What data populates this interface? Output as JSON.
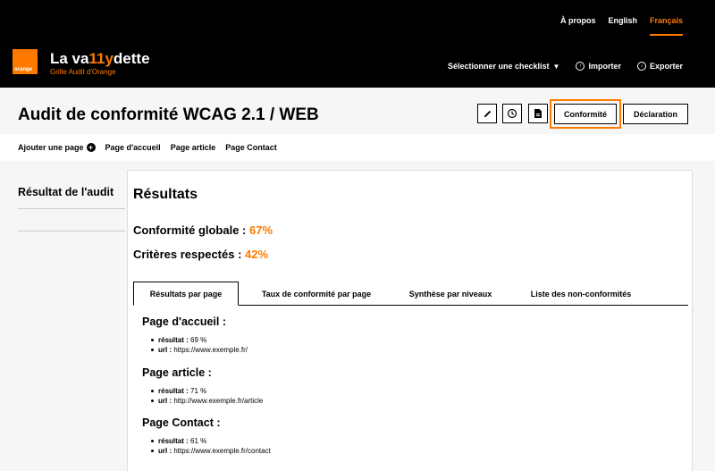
{
  "header": {
    "lang_nav": {
      "about": "À propos",
      "english": "English",
      "french": "Français"
    },
    "logo_text": "orange",
    "app_title_a": "La va",
    "app_title_b": "11y",
    "app_title_c": "dette",
    "app_subtitle": "Grille Audit d'Orange",
    "select_checklist": "Sélectionner une checklist",
    "import": "Importer",
    "export": "Exporter"
  },
  "title": "Audit de conformité WCAG 2.1 / WEB",
  "toolbar": {
    "conformite": "Conformité",
    "declaration": "Déclaration"
  },
  "subnav": {
    "add_page": "Ajouter une page",
    "pages": [
      "Page d'accueil",
      "Page article",
      "Page Contact"
    ]
  },
  "sidebar": {
    "heading": "Résultat de l'audit"
  },
  "results": {
    "title": "Résultats",
    "global_label": "Conformité globale : ",
    "global_value": "67%",
    "criteria_label": "Critères respectés : ",
    "criteria_value": "42%"
  },
  "tabs": [
    "Résultats par page",
    "Taux de conformité par page",
    "Synthèse par niveaux",
    "Liste des non-conformités"
  ],
  "pages": [
    {
      "title": "Page d'accueil :",
      "result_label": "résultat :",
      "result": " 69 %",
      "url_label": "url :",
      "url": " https://www.exemple.fr/"
    },
    {
      "title": "Page article :",
      "result_label": "résultat :",
      "result": " 71 %",
      "url_label": "url :",
      "url": " http://www.exemple.fr/article"
    },
    {
      "title": "Page Contact :",
      "result_label": "résultat :",
      "result": " 61 %",
      "url_label": "url :",
      "url": " https://www.exemple.fr/contact"
    }
  ],
  "colors": {
    "accent": "#ff7900",
    "header_bg": "#000000"
  }
}
